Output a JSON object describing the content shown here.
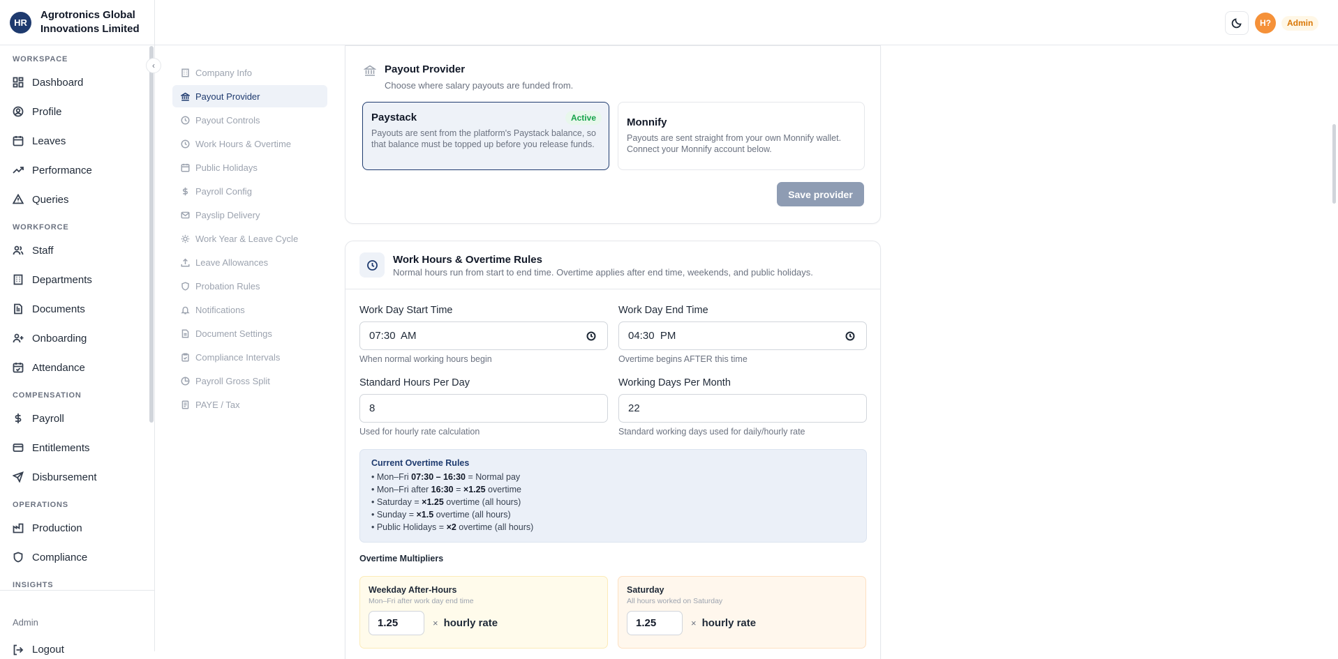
{
  "brand": {
    "initials": "HR",
    "name_line1": "Agrotronics Global",
    "name_line2": "Innovations Limited"
  },
  "sidebar": {
    "sections": {
      "workspace": "WORKSPACE",
      "workforce": "WORKFORCE",
      "compensation": "COMPENSATION",
      "operations": "OPERATIONS",
      "insights": "INSIGHTS"
    },
    "items": {
      "dashboard": "Dashboard",
      "profile": "Profile",
      "leaves": "Leaves",
      "performance": "Performance",
      "queries": "Queries",
      "staff": "Staff",
      "departments": "Departments",
      "documents": "Documents",
      "onboarding": "Onboarding",
      "attendance": "Attendance",
      "payroll": "Payroll",
      "entitlements": "Entitlements",
      "disbursement": "Disbursement",
      "production": "Production",
      "compliance": "Compliance"
    },
    "role": "Admin",
    "logout": "Logout"
  },
  "topbar": {
    "avatar_initials": "H?",
    "role_badge": "Admin"
  },
  "settings_nav": [
    "Company Info",
    "Payout Provider",
    "Payout Controls",
    "Work Hours & Overtime",
    "Public Holidays",
    "Payroll Config",
    "Payslip Delivery",
    "Work Year & Leave Cycle",
    "Leave Allowances",
    "Probation Rules",
    "Notifications",
    "Document Settings",
    "Compliance Intervals",
    "Payroll Gross Split",
    "PAYE / Tax"
  ],
  "payout": {
    "title": "Payout Provider",
    "subtitle": "Choose where salary payouts are funded from.",
    "paystack": {
      "name": "Paystack",
      "badge": "Active",
      "desc": "Payouts are sent from the platform's Paystack balance, so that balance must be topped up before you release funds."
    },
    "monnify": {
      "name": "Monnify",
      "desc": "Payouts are sent straight from your own Monnify wallet. Connect your Monnify account below."
    },
    "save_label": "Save provider"
  },
  "work_hours": {
    "title": "Work Hours & Overtime Rules",
    "subtitle": "Normal hours run from start to end time. Overtime applies after end time, weekends, and public holidays.",
    "start_label": "Work Day Start Time",
    "start_value": "07:30  AM",
    "start_help": "When normal working hours begin",
    "end_label": "Work Day End Time",
    "end_value": "04:30  PM",
    "end_help": "Overtime begins AFTER this time",
    "std_label": "Standard Hours Per Day",
    "std_value": "8",
    "std_help": "Used for hourly rate calculation",
    "days_label": "Working Days Per Month",
    "days_value": "22",
    "days_help": "Standard working days used for daily/hourly rate",
    "rules_title": "Current Overtime Rules",
    "rules": {
      "r1_pre": "• Mon–Fri ",
      "r1_b": "07:30 – 16:30",
      "r1_post": " = Normal pay",
      "r2_pre": "• Mon–Fri after ",
      "r2_b1": "16:30",
      "r2_mid": " = ",
      "r2_b2": "×1.25",
      "r2_post": " overtime",
      "r3_pre": "• Saturday = ",
      "r3_b": "×1.25",
      "r3_post": " overtime (all hours)",
      "r4_pre": "• Sunday = ",
      "r4_b": "×1.5",
      "r4_post": " overtime (all hours)",
      "r5_pre": "• Public Holidays = ",
      "r5_b": "×2",
      "r5_post": " overtime (all hours)"
    },
    "multipliers_title": "Overtime Multipliers",
    "weekday": {
      "name": "Weekday After-Hours",
      "desc": "Mon–Fri after work day end time",
      "value": "1.25",
      "x": "×",
      "unit": "hourly rate"
    },
    "saturday": {
      "name": "Saturday",
      "desc": "All hours worked on Saturday",
      "value": "1.25",
      "x": "×",
      "unit": "hourly rate"
    }
  }
}
